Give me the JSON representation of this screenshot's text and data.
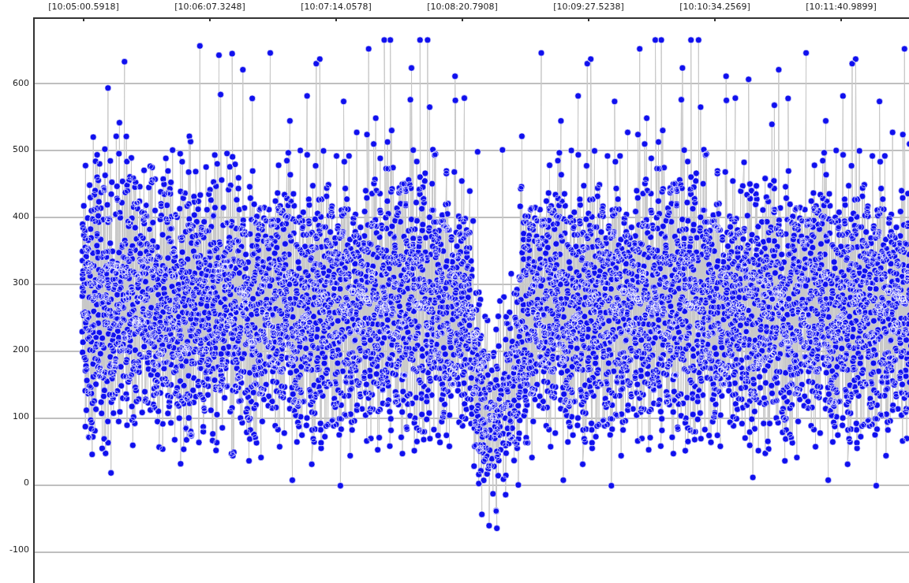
{
  "x_axis": {
    "ticks": [
      "[10:05:00.5918]",
      "[10:06:07.3248]",
      "[10:07:14.0578]",
      "[10:08:20.7908]",
      "[10:09:27.5238]",
      "[10:10:34.2569]",
      "[10:11:40.9899]"
    ]
  },
  "y_axis": {
    "ticks": [
      "600",
      "500",
      "400",
      "300",
      "200",
      "100",
      "0",
      "-100"
    ]
  }
}
